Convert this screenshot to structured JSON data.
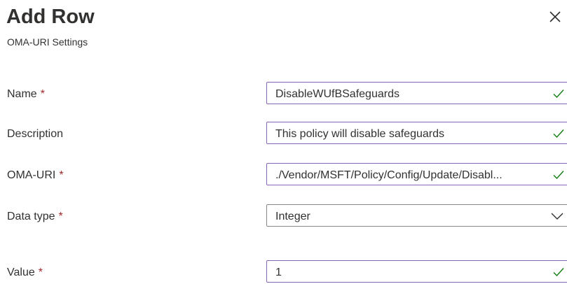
{
  "panel": {
    "title": "Add Row",
    "subtitle": "OMA-URI Settings"
  },
  "form": {
    "required_marker": "*",
    "name": {
      "label": "Name",
      "value": "DisableWUfBSafeguards"
    },
    "description": {
      "label": "Description",
      "value": "This policy will disable safeguards"
    },
    "oma_uri": {
      "label": "OMA-URI",
      "value": "./Vendor/MSFT/Policy/Config/Update/Disabl..."
    },
    "data_type": {
      "label": "Data type",
      "value": "Integer"
    },
    "value": {
      "label": "Value",
      "value": "1"
    }
  },
  "colors": {
    "valid_check": "#107c10",
    "focus_border": "#8764b8",
    "required": "#a4262c"
  },
  "icons": {
    "close": "close-icon",
    "valid": "checkmark-icon",
    "dropdown": "chevron-down-icon"
  }
}
